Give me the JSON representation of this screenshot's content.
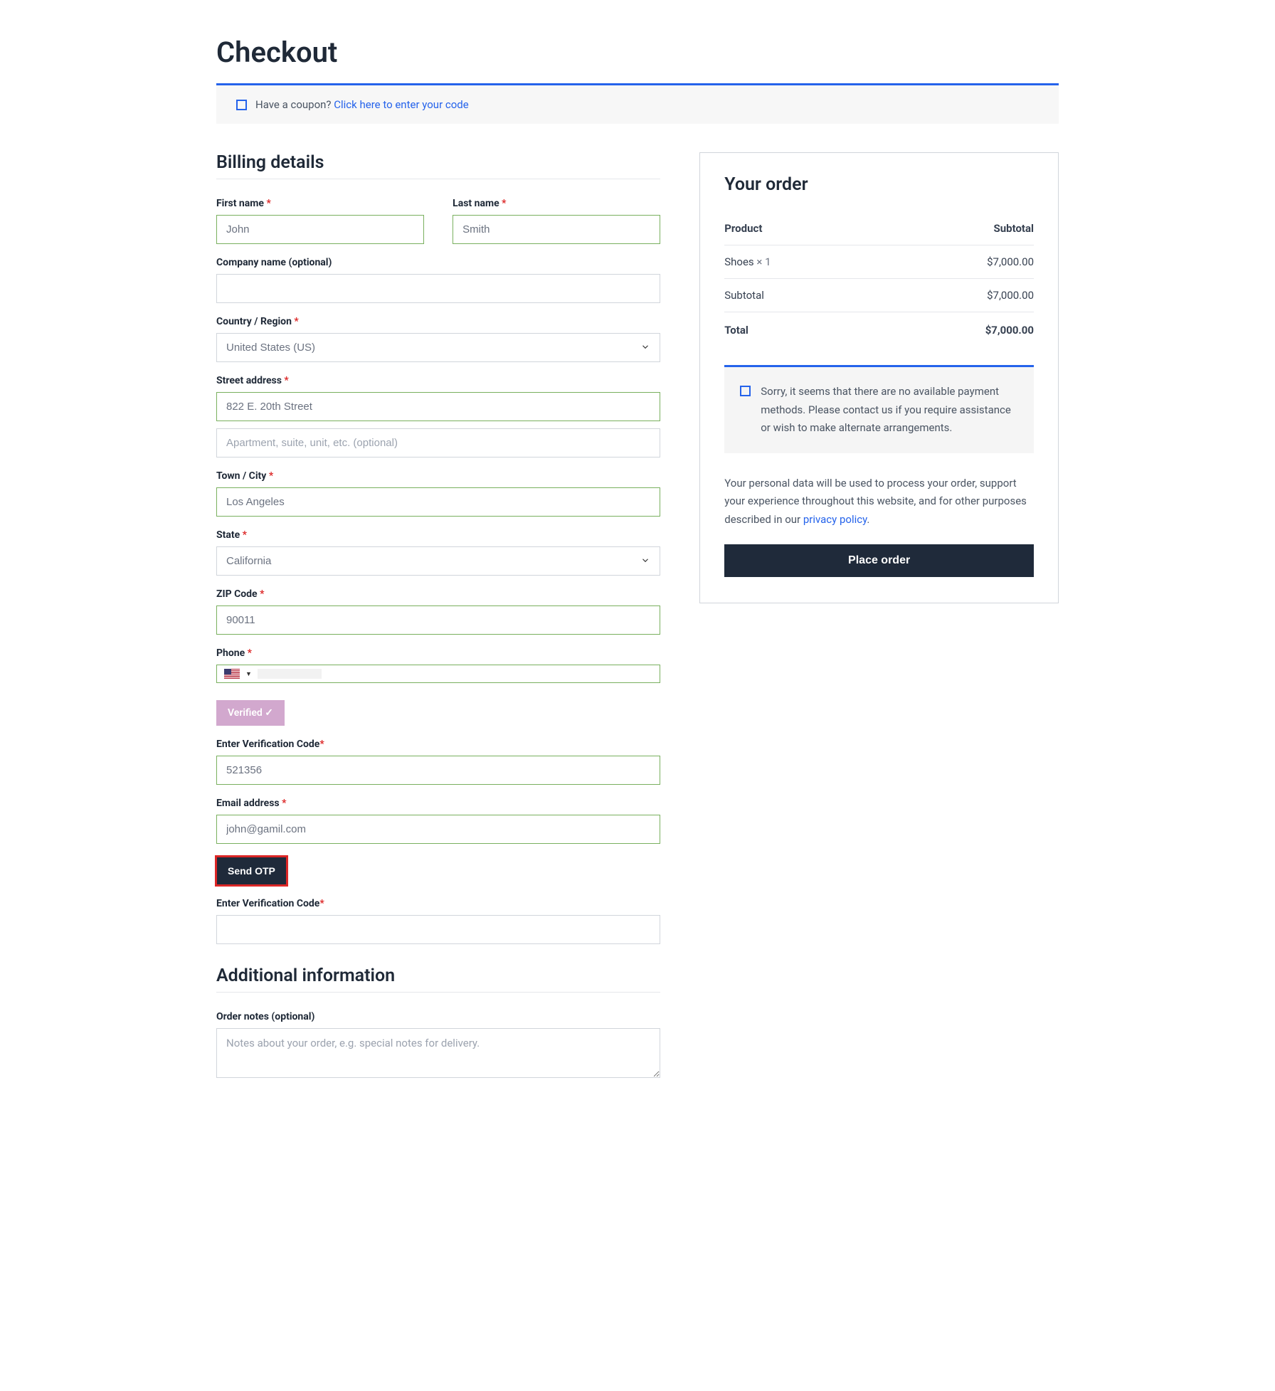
{
  "page_title": "Checkout",
  "coupon": {
    "prompt": "Have a coupon?",
    "link": "Click here to enter your code"
  },
  "billing": {
    "heading": "Billing details",
    "first_name": {
      "label": "First name",
      "value": "John"
    },
    "last_name": {
      "label": "Last name",
      "value": "Smith"
    },
    "company": {
      "label": "Company name (optional)",
      "value": ""
    },
    "country": {
      "label": "Country / Region",
      "value": "United States (US)"
    },
    "street": {
      "label": "Street address",
      "value": "822 E. 20th Street",
      "placeholder2": "Apartment, suite, unit, etc. (optional)"
    },
    "city": {
      "label": "Town / City",
      "value": "Los Angeles"
    },
    "state": {
      "label": "State",
      "value": "California"
    },
    "zip": {
      "label": "ZIP Code",
      "value": "90011"
    },
    "phone": {
      "label": "Phone",
      "value": ""
    },
    "verified": "Verified ✓",
    "verification_code": {
      "label": "Enter Verification Code",
      "value": "521356"
    },
    "email": {
      "label": "Email address",
      "value": "john@gamil.com"
    },
    "send_otp": "Send OTP",
    "verification_code2": {
      "label": "Enter Verification Code",
      "value": ""
    }
  },
  "additional": {
    "heading": "Additional information",
    "order_notes": {
      "label": "Order notes (optional)",
      "placeholder": "Notes about your order, e.g. special notes for delivery."
    }
  },
  "order": {
    "heading": "Your order",
    "product_col": "Product",
    "subtotal_col": "Subtotal",
    "items": [
      {
        "name": "Shoes",
        "qty": "× 1",
        "price": "$7,000.00"
      }
    ],
    "subtotal_label": "Subtotal",
    "subtotal_value": "$7,000.00",
    "total_label": "Total",
    "total_value": "$7,000.00",
    "no_payment_msg": "Sorry, it seems that there are no available payment methods. Please contact us if you require assistance or wish to make alternate arrangements.",
    "privacy_text": "Your personal data will be used to process your order, support your experience throughout this website, and for other purposes described in our ",
    "privacy_link": "privacy policy",
    "place_order": "Place order"
  }
}
